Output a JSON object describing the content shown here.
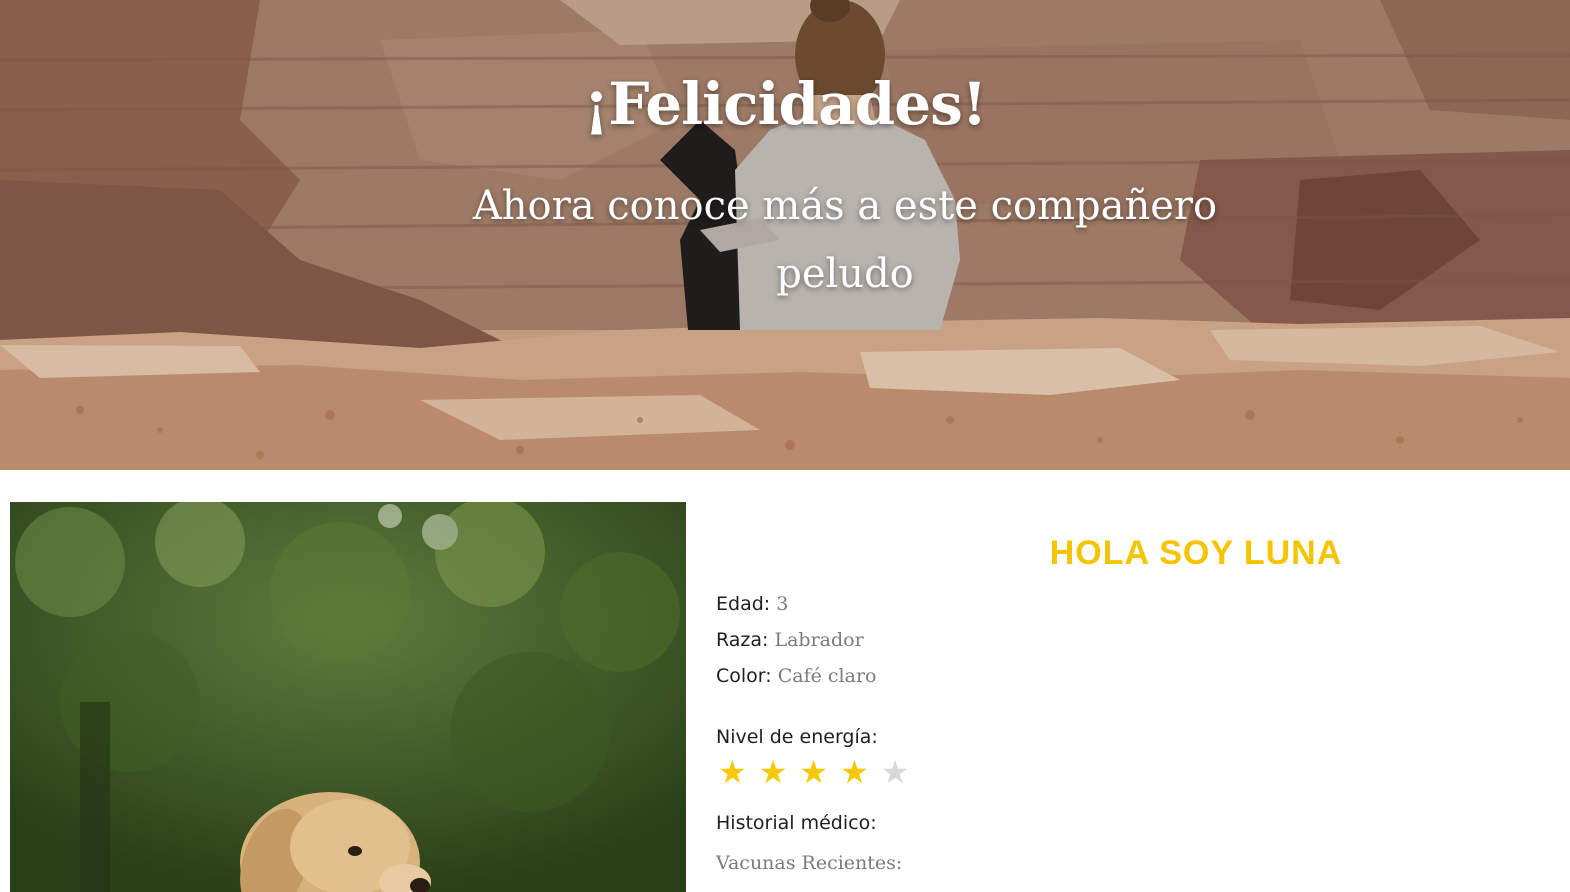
{
  "hero": {
    "title": "¡Felicidades!",
    "subtitle": "Ahora conoce más a este compañero peludo"
  },
  "pet": {
    "name": "HOLA SOY LUNA",
    "fields": [
      {
        "label": "Edad:",
        "value": "3"
      },
      {
        "label": "Raza:",
        "value": "Labrador"
      },
      {
        "label": "Color:",
        "value": "Café claro"
      }
    ],
    "energy_label": "Nivel de energía:",
    "energy_level": 4,
    "energy_max": 5,
    "medical_label": "Historial médico:",
    "medical_item": "Vacunas Recientes:"
  },
  "colors": {
    "accent": "#f5c400",
    "star_on": "#f5c800",
    "star_off": "#d8d8d8"
  },
  "icons": {
    "star": "star-icon"
  }
}
